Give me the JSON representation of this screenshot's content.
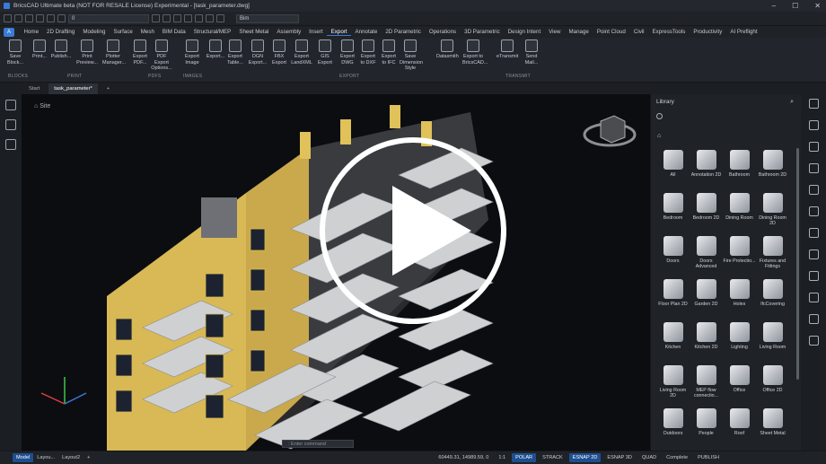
{
  "window": {
    "title": "BricsCAD Ultimate beta (NOT FOR RESALE License) Experimental - [task_parameter.dwg]",
    "controls": [
      "–",
      "☐",
      "✕"
    ]
  },
  "qat": {
    "layer": "0",
    "workspace": "Bim"
  },
  "menu": [
    "Home",
    "2D Drafting",
    "Modeling",
    "Surface",
    "Mesh",
    "BIM Data",
    "Structural/MEP",
    "Sheet Metal",
    "Assembly",
    "Insert",
    "Export",
    "Annotate",
    "2D Parametric",
    "Operations",
    "3D Parametric",
    "Design Intent",
    "View",
    "Manage",
    "Point Cloud",
    "Civil",
    "ExpressTools",
    "Productivity",
    "AI Preflight"
  ],
  "menu_active": "Export",
  "ribbon": {
    "buttons": [
      {
        "label": "Save\nBlock..."
      },
      {
        "label": "Print..."
      },
      {
        "label": "Publish..."
      },
      {
        "label": "Print\nPreview..."
      },
      {
        "label": "Plotter\nManager..."
      },
      {
        "label": "Export\nPDF..."
      },
      {
        "label": "PDF Export\nOptions..."
      },
      {
        "label": "Export\nImage"
      },
      {
        "label": "Export..."
      },
      {
        "label": "Export\nTable..."
      },
      {
        "label": "DGN\nExport..."
      },
      {
        "label": "FBX\nExport"
      },
      {
        "label": "Export\nLandXML"
      },
      {
        "label": "GIS\nExport"
      },
      {
        "label": "Export\nDWG"
      },
      {
        "label": "Export\nto DXF"
      },
      {
        "label": "Export\nto IFC"
      },
      {
        "label": "Save Dimension\nStyle"
      },
      {
        "label": "Datasmith"
      },
      {
        "label": "Export to\nBricsCAD..."
      },
      {
        "label": "eTransmit"
      },
      {
        "label": "Send\nMail..."
      }
    ],
    "groups": [
      "BLOCKS",
      "PRINT",
      "PDFS",
      "IMAGES",
      "EXPORT",
      "TRANSMIT"
    ]
  },
  "doc_tabs": [
    "Start",
    "task_parameter*",
    "+"
  ],
  "viewport": {
    "breadcrumb": "Site",
    "command_prompt": ": Enter command"
  },
  "library": {
    "title": "Library",
    "items": [
      "All",
      "Annotation 2D",
      "Bathroom",
      "Bathroom 2D",
      "Bedroom",
      "Bedroom 2D",
      "Dining Room",
      "Dining Room 2D",
      "Doors",
      "Doors Advanced",
      "Fire Protectio...",
      "Fixtures and Fittings",
      "Floor Plan 2D",
      "Garden 2D",
      "Holes",
      "IfcCovering",
      "Kitchen",
      "Kitchen 2D",
      "Lighting",
      "Living Room",
      "Living Room 2D",
      "MEP flow connectio...",
      "Office",
      "Office 2D",
      "Outdoors",
      "People",
      "Roof",
      "Sheet Metal"
    ]
  },
  "status": {
    "layouts": [
      "Model",
      "Layou...",
      "Layout2",
      "+"
    ],
    "coords": "60449.31, 14989.59, 0",
    "toggles": [
      {
        "label": "1:1",
        "on": false
      },
      {
        "label": "POLAR",
        "on": true
      },
      {
        "label": "STRACK",
        "on": false
      },
      {
        "label": "ESNAP 2D",
        "on": true
      },
      {
        "label": "ESNAP 3D",
        "on": false
      },
      {
        "label": "QUAD",
        "on": false
      },
      {
        "label": "Complete",
        "on": false
      },
      {
        "label": "PUBLISH",
        "on": false
      }
    ]
  },
  "colors": {
    "accent": "#3a7bd5",
    "facade": "#e0c15a",
    "slab": "#c9c9c9",
    "background": "#0c0d10"
  }
}
